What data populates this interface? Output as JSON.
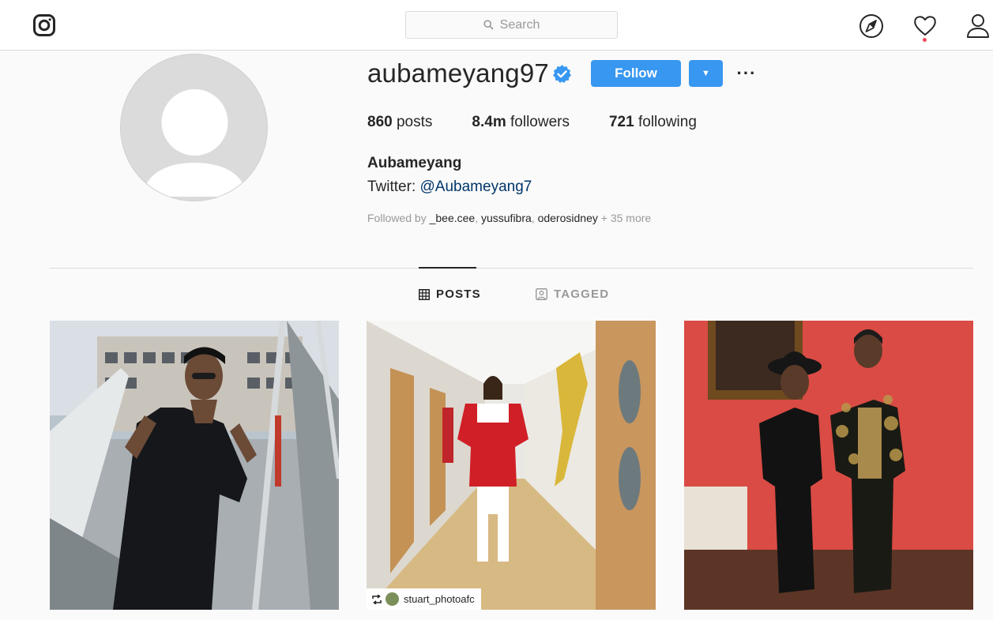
{
  "nav": {
    "search_placeholder": "Search",
    "icons": [
      "instagram-logo-icon",
      "search-icon",
      "compass-icon",
      "heart-icon",
      "user-icon"
    ],
    "notification_color": "#ed4956"
  },
  "profile": {
    "username": "aubameyang97",
    "verified": true,
    "follow_label": "Follow",
    "dropdown_label": "▼",
    "more_label": "···",
    "stats": {
      "posts_count": "860",
      "posts_label": "posts",
      "followers_count": "8.4m",
      "followers_label": "followers",
      "following_count": "721",
      "following_label": "following"
    },
    "full_name": "Aubameyang",
    "bio_prefix": "Twitter: ",
    "bio_link": "@Aubameyang7",
    "followed_by": {
      "prefix": "Followed by ",
      "names": [
        "_bee.cee",
        "yussufibra",
        "oderosidney"
      ],
      "suffix": "+ 35 more"
    }
  },
  "tabs": {
    "posts_label": "POSTS",
    "tagged_label": "TAGGED",
    "active": "POSTS"
  },
  "posts": [
    {
      "kind": "photo"
    },
    {
      "kind": "photo",
      "repost_user": "stuart_photoafc"
    },
    {
      "kind": "photo"
    }
  ],
  "colors": {
    "accent": "#3897f0",
    "link": "#003569",
    "muted": "#999999",
    "text": "#262626"
  }
}
